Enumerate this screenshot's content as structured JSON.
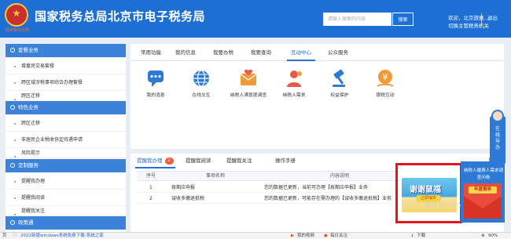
{
  "header": {
    "emblem_caption": "国家税务总局",
    "site_title": "国家税务总局北京市电子税务局",
    "search_placeholder": "请输入搜索的内容",
    "search_button": "搜索",
    "welcome_text": "欢迎，北京旅雅...",
    "switch_text": "切换主管税务机关",
    "logout": "退出",
    "brand_color": "#1d6fd3"
  },
  "sidebar": {
    "sections": [
      {
        "title": "套餐业务",
        "items": [
          "增量房交易套餐",
          "跨区域涉税事项综合办理套餐",
          "跨区迁移"
        ]
      },
      {
        "title": "特色业务",
        "items": [
          "跨区迁移",
          "非居民企业税收协定待遇申请",
          "风险提示"
        ]
      },
      {
        "title": "定制服务",
        "items": [
          "提醒我办理",
          "提醒我阅读",
          "提醒我关注"
        ]
      },
      {
        "title": "政策通",
        "items": []
      }
    ]
  },
  "top_tabs": [
    "常用功能",
    "我的信息",
    "我要办税",
    "我要查询",
    "互动中心",
    "公众服务"
  ],
  "active_top_tab": "互动中心",
  "features": [
    {
      "label": "我的消息",
      "icon": "message-icon"
    },
    {
      "label": "在线交互",
      "icon": "globe-icon"
    },
    {
      "label": "纳税人满意度调查",
      "icon": "survey-icon"
    },
    {
      "label": "纳税人需求",
      "icon": "user-need-icon"
    },
    {
      "label": "权益保护",
      "icon": "gavel-icon"
    },
    {
      "label": "银税互动",
      "icon": "yuan-coin-icon"
    }
  ],
  "bottom": {
    "sub_tabs": [
      "提醒我办理",
      "提醒我阅读",
      "提醒我关注",
      "操作手册"
    ],
    "active_sub_tab": "提醒我办理",
    "badge_count": "2",
    "more_link": "更多",
    "columns": [
      "序号",
      "事项名称",
      "内容说明"
    ],
    "rows": [
      {
        "no": "1",
        "name": "按期应申报",
        "desc": "您的数据已更新，当前可办理【按期应申报】业务"
      },
      {
        "no": "2",
        "name": "误收多缴退抵税",
        "desc": "您的数据已更新，可能存在需办理的【误收多缴退抵税】业务"
      }
    ]
  },
  "promo": {
    "title": "谢谢鼠福",
    "sub": "立即抽奖",
    "watermark": "激活 Windows"
  },
  "side_card": {
    "text": "纳税人缴费人需求调查问卷",
    "banner": "年度报单"
  },
  "online_service": {
    "text": "在线导办"
  },
  "statusbar": {
    "page_text": "页",
    "news": "2022新版windows系统免费下载-系统之家",
    "video": "我的视频",
    "hot": "每日关注",
    "download": "下载",
    "zoom": "90%"
  }
}
